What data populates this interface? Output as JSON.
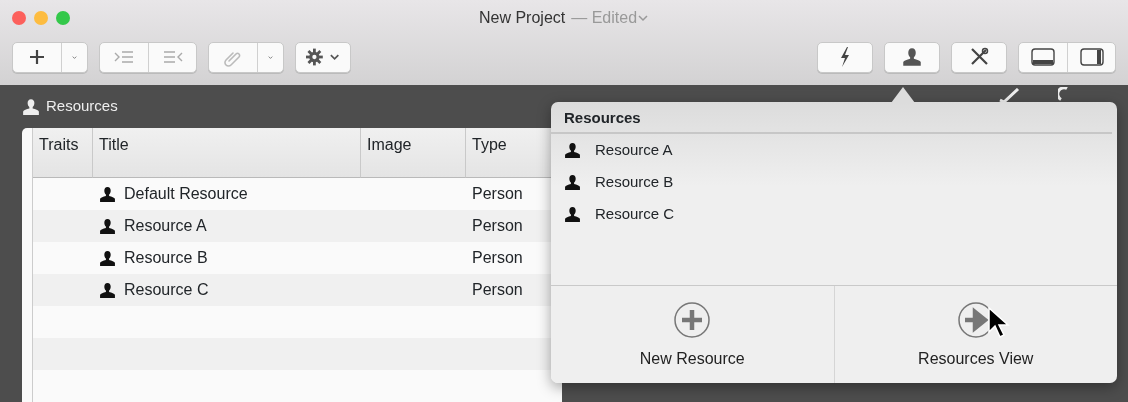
{
  "window": {
    "title": "New Project",
    "subtitle": "— Edited"
  },
  "panel": {
    "title": "Resources"
  },
  "table": {
    "columns": [
      "Traits",
      "Title",
      "Image",
      "Type"
    ],
    "rows": [
      {
        "title": "Default Resource",
        "type": "Person"
      },
      {
        "title": "Resource A",
        "type": "Person"
      },
      {
        "title": "Resource B",
        "type": "Person"
      },
      {
        "title": "Resource C",
        "type": "Person"
      }
    ]
  },
  "popover": {
    "title": "Resources",
    "items": [
      {
        "label": "Resource A"
      },
      {
        "label": "Resource B"
      },
      {
        "label": "Resource C"
      }
    ],
    "actions": [
      {
        "label": "New Resource",
        "kind": "add"
      },
      {
        "label": "Resources View",
        "kind": "go"
      }
    ]
  }
}
